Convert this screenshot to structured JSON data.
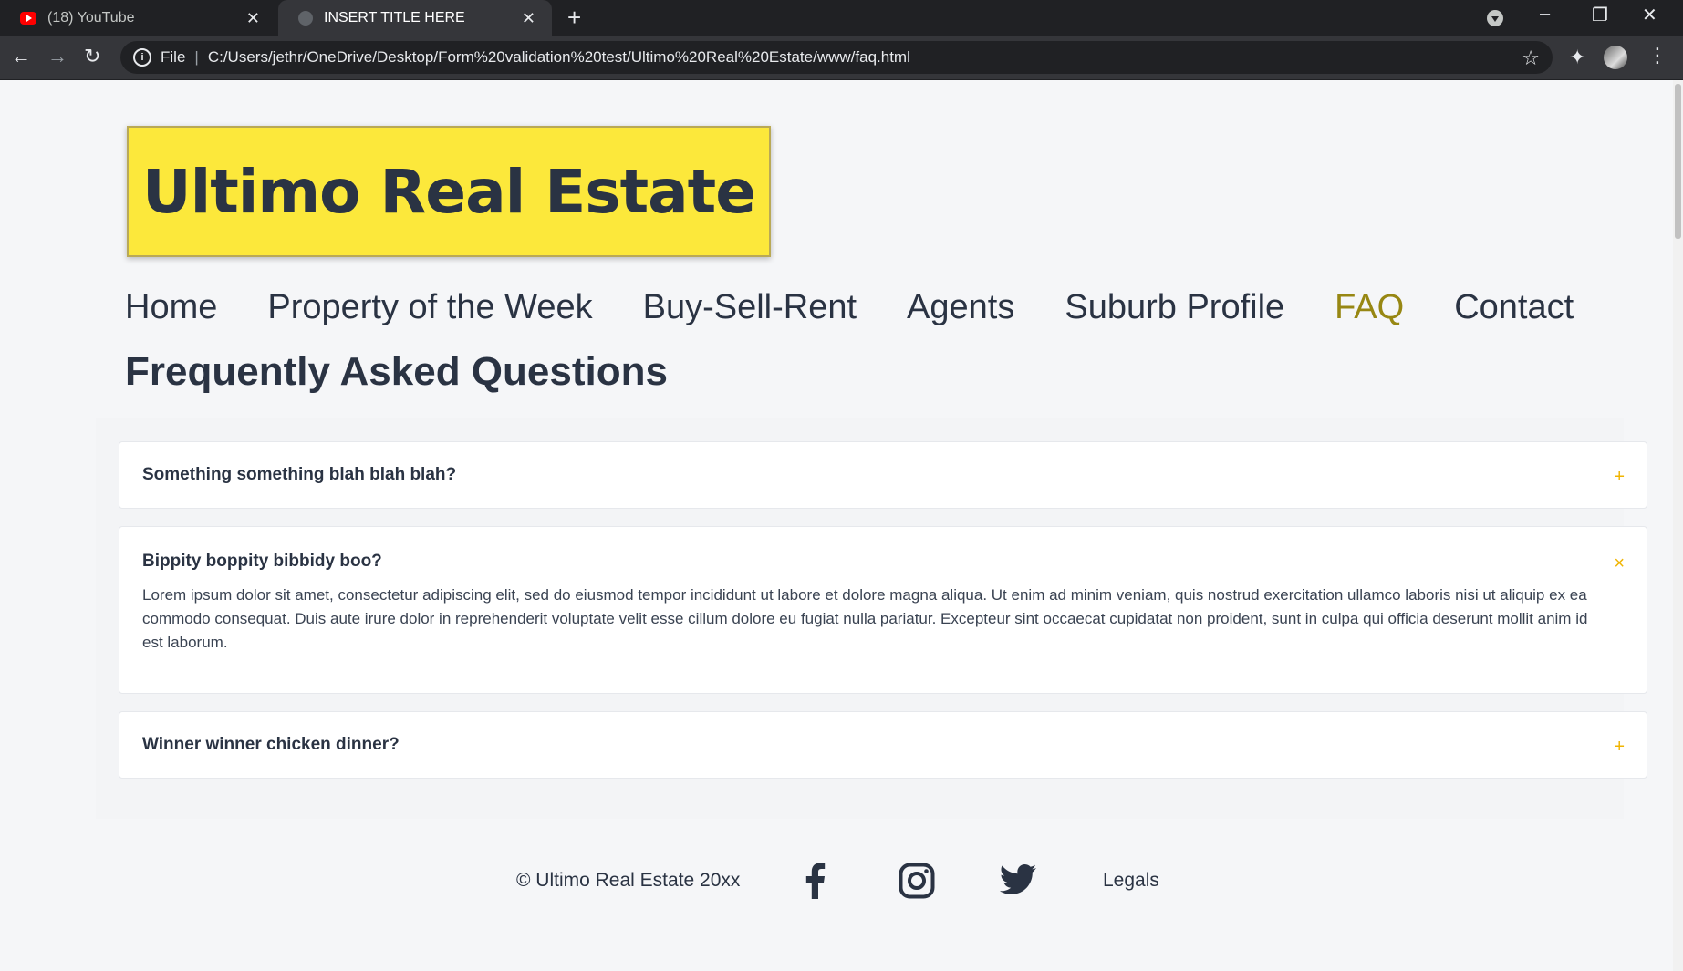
{
  "browser": {
    "tabs": [
      {
        "title": "(18) YouTube",
        "favicon": "youtube-icon"
      },
      {
        "title": "INSERT TITLE HERE",
        "favicon": "globe-icon"
      }
    ],
    "new_tab_symbol": "+",
    "close_symbol": "✕",
    "address": {
      "scheme_label": "File",
      "url": "C:/Users/jethr/OneDrive/Desktop/Form%20validation%20test/Ultimo%20Real%20Estate/www/faq.html"
    }
  },
  "site": {
    "logo_text": "Ultimo Real Estate",
    "nav": [
      "Home",
      "Property of the Week",
      "Buy-Sell-Rent",
      "Agents",
      "Suburb Profile",
      "FAQ",
      "Contact"
    ],
    "active_nav": "FAQ",
    "title": "Frequently Asked Questions"
  },
  "faq": [
    {
      "question": "Something something blah blah blah?",
      "toggle": "+",
      "expanded": false,
      "answer": ""
    },
    {
      "question": "Bippity boppity bibbidy boo?",
      "toggle": "×",
      "expanded": true,
      "answer": "Lorem ipsum dolor sit amet, consectetur adipiscing elit, sed do eiusmod tempor incididunt ut labore et dolore magna aliqua. Ut enim ad minim veniam, quis nostrud exercitation ullamco laboris nisi ut aliquip ex ea commodo consequat. Duis aute irure dolor in reprehenderit voluptate velit esse cillum dolore eu fugiat nulla pariatur. Excepteur sint occaecat cupidatat non proident, sunt in culpa qui officia deserunt mollit anim id est laborum."
    },
    {
      "question": "Winner winner chicken dinner?",
      "toggle": "+",
      "expanded": false,
      "answer": ""
    }
  ],
  "footer": {
    "copyright": "© Ultimo Real Estate 20xx",
    "social": [
      "facebook-icon",
      "instagram-icon",
      "twitter-icon"
    ],
    "legals": "Legals"
  },
  "colors": {
    "accent": "#978713",
    "logo_bg": "#fce83b",
    "text": "#2a3343",
    "toggle": "#f0b400"
  }
}
